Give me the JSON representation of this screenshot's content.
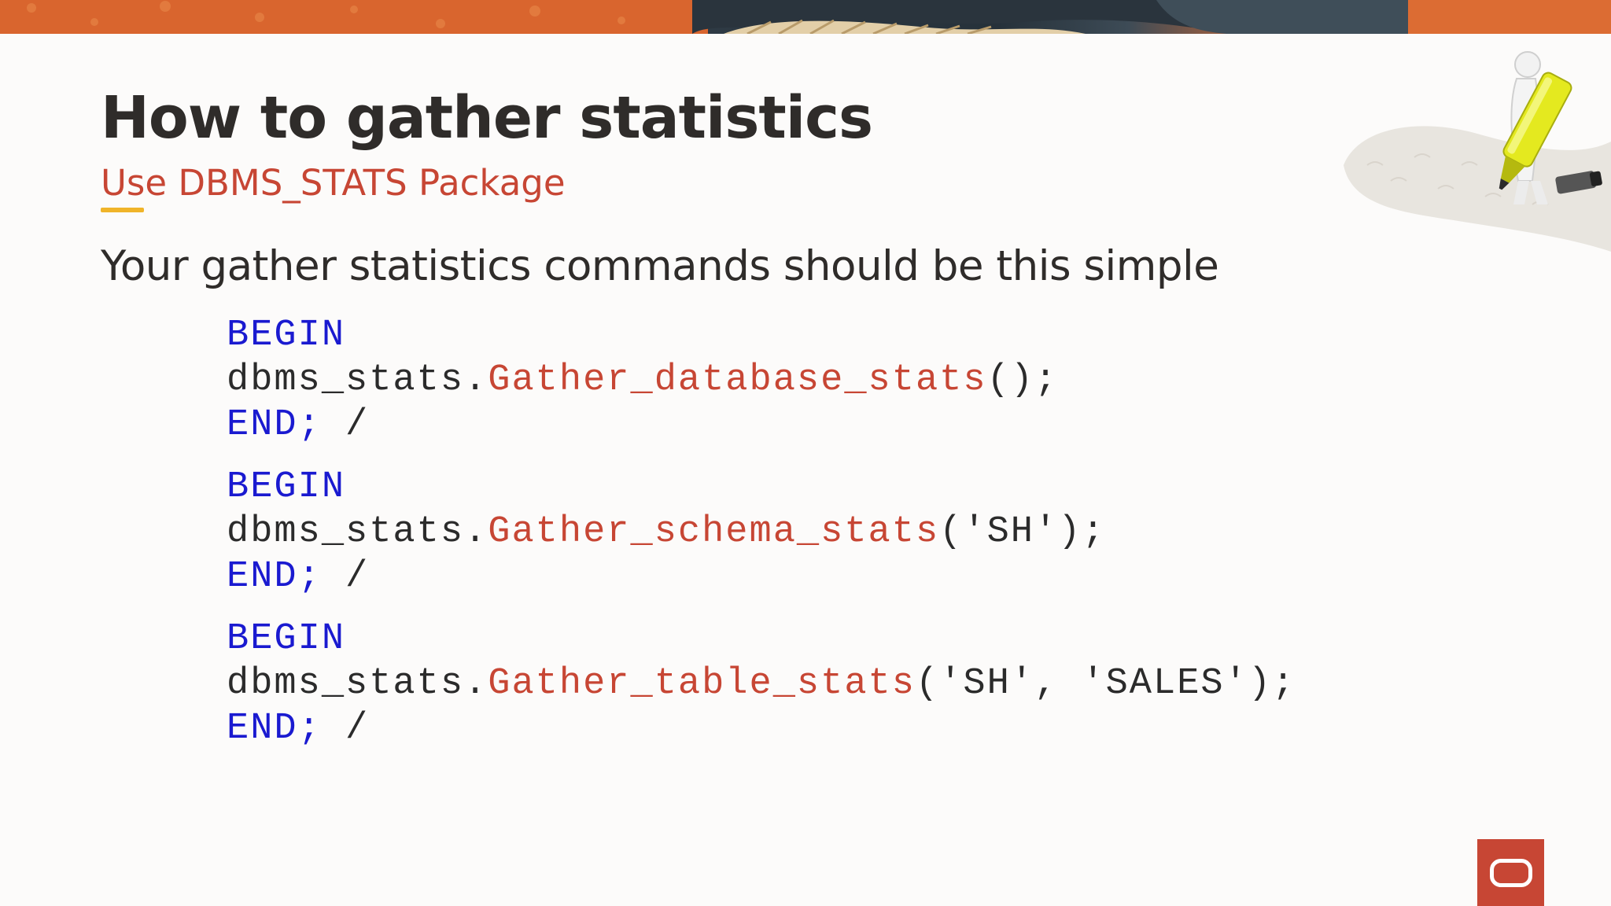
{
  "slide": {
    "title": "How to gather statistics",
    "subtitle": "Use DBMS_STATS Package",
    "intro": "Your gather statistics commands should be this simple"
  },
  "code_blocks": [
    {
      "begin": "BEGIN",
      "prefix": "dbms_stats.",
      "function": "Gather_database_stats",
      "args": "();",
      "end": "END;",
      "slash": " /"
    },
    {
      "begin": "BEGIN",
      "prefix": "dbms_stats.",
      "function": "Gather_schema_stats",
      "args": "('SH');",
      "end": "END;",
      "slash": " /"
    },
    {
      "begin": "BEGIN",
      "prefix": "dbms_stats.",
      "function": "Gather_table_stats",
      "args": "('SH', 'SALES');",
      "end": "END;",
      "slash": " /"
    }
  ],
  "colors": {
    "title": "#2f2c2a",
    "subtitle": "#c74634",
    "accent_underline": "#f0b429",
    "keyword": "#1a1ad0",
    "function": "#c74634",
    "logo_bg": "#c74634"
  },
  "icons": {
    "figure": "person-with-highlighter-icon",
    "logo": "oracle-logo-icon"
  }
}
